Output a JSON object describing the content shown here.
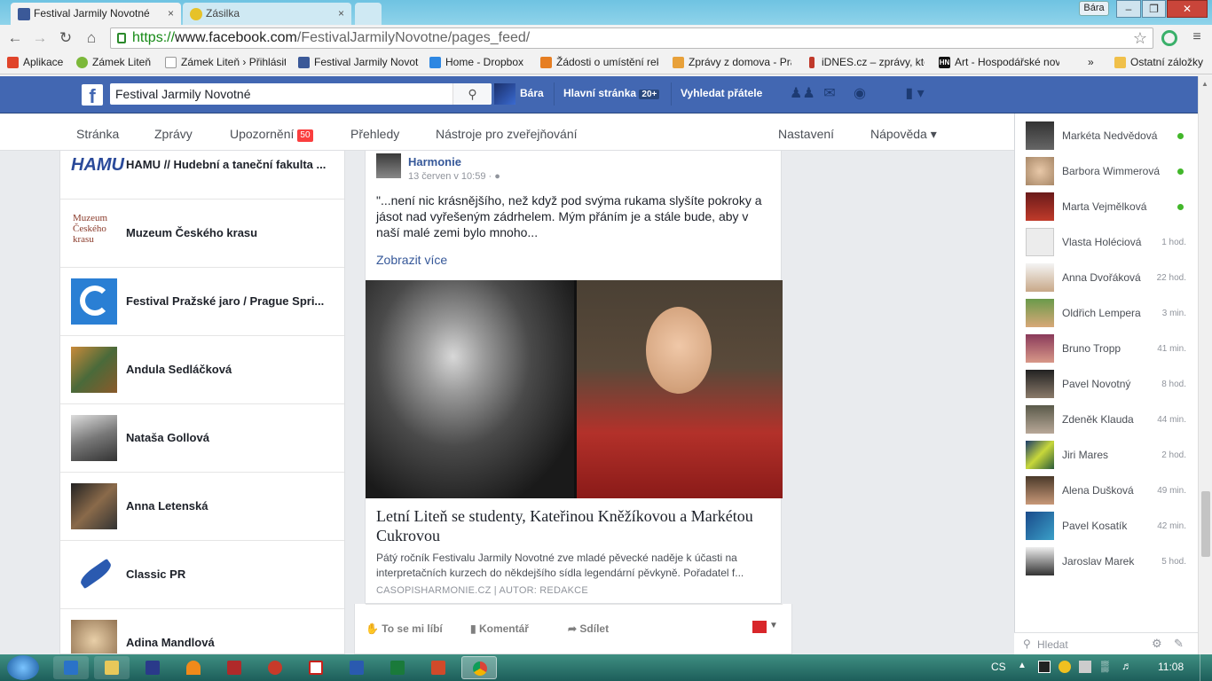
{
  "browser": {
    "tabs": [
      {
        "title": "Festival Jarmily Novotné",
        "close": "×"
      },
      {
        "title": "Zásilka",
        "close": "×"
      }
    ],
    "user": "Bára",
    "window_buttons": {
      "minimize": "–",
      "maximize": "❐",
      "close": "✕"
    },
    "url_https": "https://",
    "url_host": "www.facebook.com",
    "url_path": "/FestivalJarmilyNovotne/pages_feed/",
    "bookmarks": [
      {
        "label": "Aplikace",
        "color": "#e0442a"
      },
      {
        "label": "Zámek Liteň",
        "color": "#7cb83a"
      },
      {
        "label": "Zámek Liteň › Přihlásit",
        "color": "#dddddd"
      },
      {
        "label": "Festival Jarmily Novot",
        "color": "#3b5998"
      },
      {
        "label": "Home - Dropbox",
        "color": "#2d87e2"
      },
      {
        "label": "Žádosti o umístění rek",
        "color": "#e67e22"
      },
      {
        "label": "Zprávy z domova - Pra",
        "color": "#e8a13a"
      },
      {
        "label": "iDNES.cz – zprávy, kte",
        "color": "#c0392b"
      },
      {
        "label": "Art - Hospodářské nov",
        "color": "#111111"
      }
    ],
    "bookmarks_more": "»",
    "other_bookmarks": "Ostatní záložky"
  },
  "facebook": {
    "logo": "f",
    "search_value": "Festival Jarmily Novotné",
    "user": "Bára",
    "home": "Hlavní stránka",
    "home_badge": "20+",
    "find_friends": "Vyhledat přátele"
  },
  "page_nav": {
    "items": [
      "Stránka",
      "Zprávy",
      "Upozornění",
      "Přehledy",
      "Nástroje pro zveřejňování"
    ],
    "notifications_badge": "50",
    "settings": "Nastavení",
    "help": "Nápověda ▾"
  },
  "liked_pages": [
    {
      "name": "HAMU // Hudební a taneční fakulta ..."
    },
    {
      "name": "Muzeum Českého krasu",
      "thumb_text": "Muzeum Českého krasu"
    },
    {
      "name": "Festival Pražské jaro / Prague Spri..."
    },
    {
      "name": "Andula Sedláčková"
    },
    {
      "name": "Nataša Gollová"
    },
    {
      "name": "Anna Letenská"
    },
    {
      "name": "Classic PR"
    },
    {
      "name": "Adina Mandlová"
    }
  ],
  "post": {
    "author": "Harmonie",
    "time": "13 červen v 10:59 ·",
    "text": "\"...není nic krásnějšího, než když pod svýma rukama slyšíte pokroky a jásot nad vyřešeným zádrhelem. Mým přáním je a stále bude, aby v naší malé zemi bylo mnoho...",
    "see_more": "Zobrazit více",
    "link_title": "Letní Liteň se studenty, Kateřinou Kněžíkovou a Markétou Cukrovou",
    "link_desc": "Pátý ročník Festivalu Jarmily Novotné zve mladé pěvecké naděje k účasti na interpretačních kurzech do někdejšího sídla legendární pěvkyně. Pořadatel f...",
    "link_source": "CASOPISHARMONIE.CZ | AUTOR: REDAKCE",
    "actions": {
      "like": "To se mi líbí",
      "comment": "Komentář",
      "share": "Sdílet"
    }
  },
  "chat": {
    "contacts": [
      {
        "name": "Markéta Nedvědová",
        "status": "online"
      },
      {
        "name": "Barbora Wimmerová",
        "status": "online"
      },
      {
        "name": "Marta Vejmělková",
        "status": "online"
      },
      {
        "name": "Vlasta Holéciová",
        "status": "1 hod."
      },
      {
        "name": "Anna Dvořáková",
        "status": "22 hod."
      },
      {
        "name": "Oldřich Lempera",
        "status": "3 min."
      },
      {
        "name": "Bruno Tropp",
        "status": "41 min."
      },
      {
        "name": "Pavel Novotný",
        "status": "8 hod."
      },
      {
        "name": "Zdeněk Klauda",
        "status": "44 min."
      },
      {
        "name": "Jiri Mares",
        "status": "2 hod."
      },
      {
        "name": "Alena Dušková",
        "status": "49 min."
      },
      {
        "name": "Pavel Kosatík",
        "status": "42 min."
      },
      {
        "name": "Jaroslav Marek",
        "status": "5 hod."
      }
    ],
    "search_placeholder": "Hledat"
  },
  "taskbar": {
    "language": "CS",
    "clock": "11:08"
  }
}
